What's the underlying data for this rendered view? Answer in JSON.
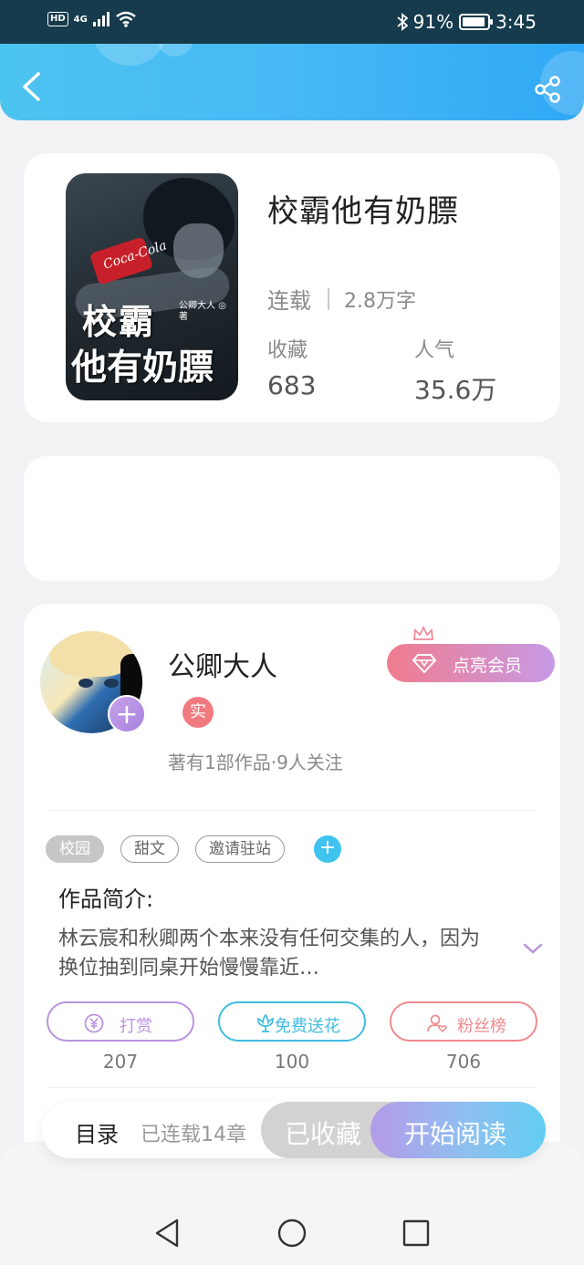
{
  "status_bar": {
    "hd": "HD",
    "signal": "4G",
    "battery_percent": "91%",
    "battery_level": 0.91,
    "time": "3:45"
  },
  "colors": {
    "header_gradient": [
      "#4cc4f0",
      "#2fa8f5"
    ],
    "vip_gradient": [
      "#f07c8e",
      "#c79ae6"
    ],
    "tip_color": "#b993e0",
    "flower_color": "#3fbde0",
    "fans_color": "#ef8a8e",
    "read_gradient": [
      "#b59be8",
      "#62cdf2"
    ]
  },
  "header": {
    "back_icon": "back-arrow-icon",
    "share_icon": "share-icon"
  },
  "book": {
    "cover_title_line1": "校霸",
    "cover_title_line2": "他有奶膘",
    "cover_can_text": "Coca-Cola",
    "cover_author_mark": "公卿大人 ◎ 著",
    "title": "校霸他有奶膘",
    "status": "连载",
    "word_count": "2.8万字",
    "collect_label": "收藏",
    "collect_value": "683",
    "popularity_label": "人气",
    "popularity_value": "35.6万"
  },
  "author": {
    "name": "公卿大人",
    "verified_badge": "实",
    "meta": "著有1部作品·9人关注",
    "vip_button": "点亮会员",
    "follow_icon": "plus-icon"
  },
  "tags": [
    {
      "label": "校园"
    },
    {
      "label": "甜文"
    },
    {
      "label": "邀请驻站"
    }
  ],
  "intro": {
    "title": "作品简介:",
    "text": "林云宸和秋卿两个本来没有任何交集的人，因为换位抽到同桌开始慢慢靠近…"
  },
  "actions": [
    {
      "label": "打赏",
      "count": "207",
      "icon": "yen-coin-icon"
    },
    {
      "label": "免费送花",
      "count": "100",
      "icon": "flower-icon"
    },
    {
      "label": "粉丝榜",
      "count": "706",
      "icon": "user-heart-icon"
    }
  ],
  "bottom_bar": {
    "catalog": "目录",
    "chapters": "已连载14章",
    "collected": "已收藏",
    "start_reading": "开始阅读"
  },
  "nav": {
    "back": "nav-back-icon",
    "home": "nav-home-icon",
    "recents": "nav-recents-icon"
  }
}
